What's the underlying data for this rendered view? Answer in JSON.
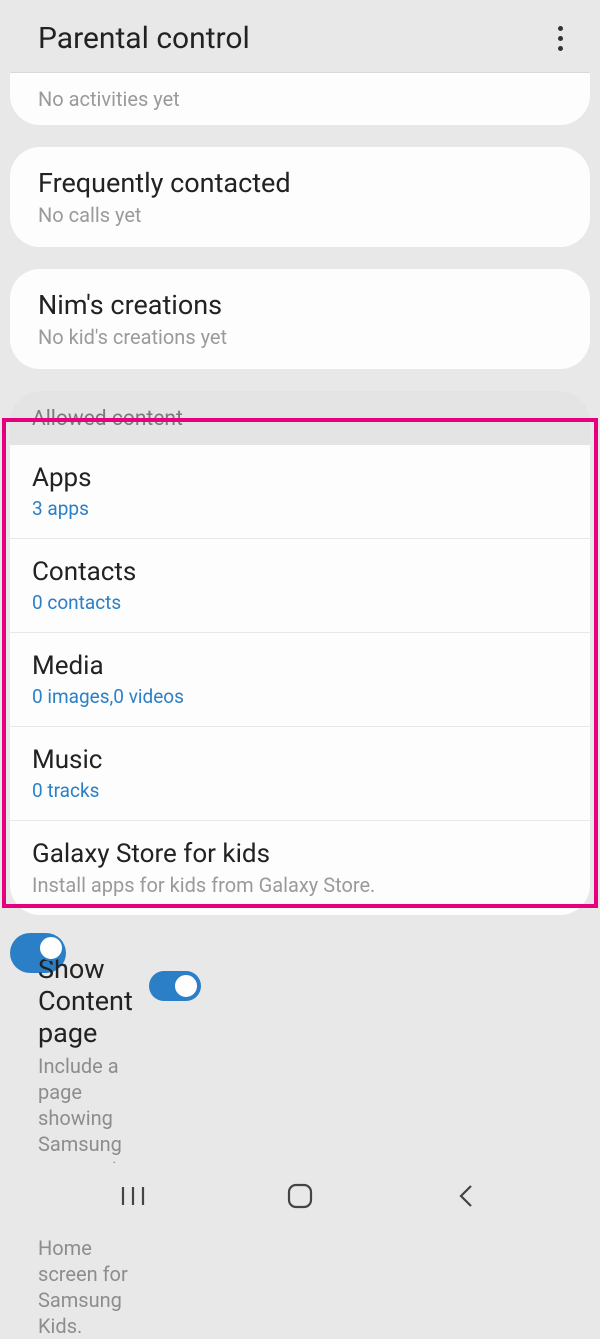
{
  "header": {
    "title": "Parental control"
  },
  "activities": {
    "sub": "No activities yet"
  },
  "frequently": {
    "title": "Frequently contacted",
    "sub": "No calls yet"
  },
  "creations": {
    "title": "Nim's creations",
    "sub": "No kid's creations yet"
  },
  "allowed": {
    "header": "Allowed content",
    "apps": {
      "title": "Apps",
      "sub": "3 apps"
    },
    "contacts": {
      "title": "Contacts",
      "sub": "0 contacts"
    },
    "media": {
      "title": "Media",
      "sub": "0 images,0 videos"
    },
    "music": {
      "title": "Music",
      "sub": "0 tracks"
    }
  },
  "galaxy": {
    "title": "Galaxy Store for kids",
    "sub": "Install apps for kids from Galaxy Store."
  },
  "contentPage": {
    "title": "Show Content page",
    "sub": "Include a page showing Samsung partners' content on the Home screen for Samsung Kids.",
    "enabled": true
  }
}
